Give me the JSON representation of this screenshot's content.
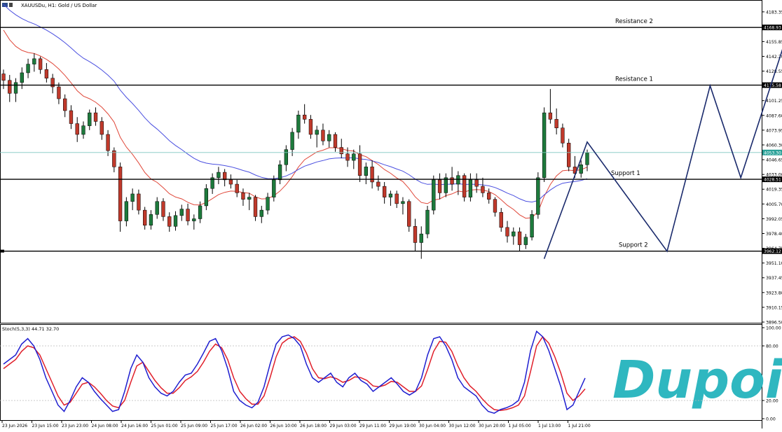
{
  "header": {
    "symbol_line": "XAUUSDu, H1: Gold / US Dollar",
    "stoch_label": "Stoch(5,3,3) 44.71 32.70"
  },
  "watermark": {
    "text": "Dupoin",
    "color": "#2fb7c0"
  },
  "colors": {
    "bull": "#1d7a3c",
    "bear": "#c0392b",
    "ma_fast": "#e0483a",
    "ma_slow": "#4a4fe0",
    "pattern": "#1a2a6c",
    "stoch_k": "#1f1fd0",
    "stoch_d": "#e01f2a",
    "current": "#2aa198"
  },
  "chart_data": [
    {
      "type": "candlestick",
      "title": "XAUUSDu, H1: Gold / US Dollar",
      "price_ticks": [
        "4183.35",
        "4169.60",
        "4155.85",
        "4142.20",
        "4128.55",
        "4115.58",
        "4101.25",
        "4087.60",
        "4073.95",
        "4060.30",
        "4053.30",
        "4046.65",
        "4033.00",
        "4028.51",
        "4019.35",
        "4005.70",
        "3992.05",
        "3978.40",
        "3964.75",
        "3962.12",
        "3951.10",
        "3937.45",
        "3923.80",
        "3910.15",
        "3896.50"
      ],
      "time_labels": [
        "23 Jun 2026",
        "23 Jun 15:00",
        "23 Jun 23:00",
        "24 Jun 08:00",
        "24 Jun 16:00",
        "25 Jun 01:00",
        "25 Jun 09:00",
        "25 Jun 17:00",
        "26 Jun 02:00",
        "26 Jun 10:00",
        "26 Jun 18:00",
        "29 Jun 03:00",
        "29 Jun 11:00",
        "29 Jun 19:00",
        "30 Jun 04:00",
        "30 Jun 12:00",
        "30 Jun 20:00",
        "1 Jul 05:00",
        "1 Jul 13:00",
        "1 Jul 21:00"
      ],
      "ylim": [
        3896.5,
        4193
      ],
      "levels": [
        {
          "name": "Resistance 2",
          "value": 4168.93,
          "tag": "4168.93"
        },
        {
          "name": "Resistance 1",
          "value": 4115.58,
          "tag": "4115.58"
        },
        {
          "name": "Support 1",
          "value": 4028.51,
          "tag": "4028.51"
        },
        {
          "name": "Support 2",
          "value": 3962.12,
          "tag": "3962.12"
        }
      ],
      "current_price": {
        "value": 4053.3,
        "tag": "4053.30"
      },
      "pattern_path": [
        [
          88,
          3955
        ],
        [
          95,
          4063
        ],
        [
          108,
          3962
        ],
        [
          115,
          4115
        ],
        [
          120,
          4030
        ],
        [
          128,
          4170
        ]
      ],
      "candles": [
        [
          4126,
          4130,
          4112,
          4120
        ],
        [
          4120,
          4125,
          4100,
          4108
        ],
        [
          4108,
          4122,
          4100,
          4118
        ],
        [
          4118,
          4132,
          4112,
          4127
        ],
        [
          4127,
          4140,
          4122,
          4135
        ],
        [
          4135,
          4145,
          4128,
          4140
        ],
        [
          4140,
          4142,
          4126,
          4130
        ],
        [
          4130,
          4136,
          4118,
          4122
        ],
        [
          4122,
          4126,
          4108,
          4114
        ],
        [
          4114,
          4118,
          4098,
          4103
        ],
        [
          4103,
          4107,
          4086,
          4092
        ],
        [
          4092,
          4097,
          4075,
          4080
        ],
        [
          4080,
          4086,
          4063,
          4070
        ],
        [
          4070,
          4082,
          4066,
          4078
        ],
        [
          4078,
          4093,
          4074,
          4090
        ],
        [
          4090,
          4095,
          4078,
          4082
        ],
        [
          4082,
          4086,
          4065,
          4070
        ],
        [
          4070,
          4074,
          4050,
          4055
        ],
        [
          4055,
          4058,
          4035,
          4040
        ],
        [
          4040,
          4044,
          3980,
          3990
        ],
        [
          3990,
          4012,
          3985,
          4008
        ],
        [
          4008,
          4020,
          4000,
          4015
        ],
        [
          4015,
          4019,
          3996,
          4000
        ],
        [
          4000,
          4003,
          3982,
          3986
        ],
        [
          3986,
          4000,
          3982,
          3996
        ],
        [
          3996,
          4012,
          3992,
          4008
        ],
        [
          4008,
          4011,
          3990,
          3994
        ],
        [
          3994,
          3998,
          3980,
          3985
        ],
        [
          3985,
          3999,
          3981,
          3995
        ],
        [
          3995,
          4005,
          3990,
          4001
        ],
        [
          4001,
          4006,
          3986,
          3990
        ],
        [
          3990,
          3996,
          3982,
          3992
        ],
        [
          3992,
          4008,
          3988,
          4004
        ],
        [
          4004,
          4024,
          4000,
          4020
        ],
        [
          4020,
          4034,
          4015,
          4030
        ],
        [
          4030,
          4040,
          4024,
          4035
        ],
        [
          4035,
          4038,
          4022,
          4028
        ],
        [
          4028,
          4033,
          4020,
          4024
        ],
        [
          4024,
          4028,
          4012,
          4016
        ],
        [
          4016,
          4020,
          4004,
          4010
        ],
        [
          4010,
          4016,
          4000,
          4012
        ],
        [
          4012,
          4014,
          3990,
          3994
        ],
        [
          3994,
          4004,
          3988,
          4000
        ],
        [
          4000,
          4016,
          3996,
          4012
        ],
        [
          4012,
          4032,
          4008,
          4028
        ],
        [
          4028,
          4046,
          4024,
          4042
        ],
        [
          4042,
          4060,
          4036,
          4056
        ],
        [
          4056,
          4076,
          4050,
          4072
        ],
        [
          4072,
          4092,
          4066,
          4088
        ],
        [
          4088,
          4098,
          4080,
          4084
        ],
        [
          4084,
          4088,
          4066,
          4070
        ],
        [
          4070,
          4078,
          4058,
          4074
        ],
        [
          4074,
          4080,
          4060,
          4064
        ],
        [
          4064,
          4074,
          4058,
          4070
        ],
        [
          4070,
          4072,
          4054,
          4058
        ],
        [
          4058,
          4066,
          4048,
          4052
        ],
        [
          4052,
          4058,
          4040,
          4046
        ],
        [
          4046,
          4056,
          4038,
          4052
        ],
        [
          4052,
          4060,
          4026,
          4032
        ],
        [
          4032,
          4044,
          4024,
          4040
        ],
        [
          4040,
          4046,
          4020,
          4026
        ],
        [
          4026,
          4032,
          4018,
          4022
        ],
        [
          4022,
          4026,
          4006,
          4012
        ],
        [
          4012,
          4018,
          4004,
          4015
        ],
        [
          4015,
          4018,
          4002,
          4006
        ],
        [
          4006,
          4012,
          3996,
          4008
        ],
        [
          4008,
          4010,
          3980,
          3985
        ],
        [
          3985,
          3992,
          3962,
          3970
        ],
        [
          3970,
          3985,
          3955,
          3978
        ],
        [
          3978,
          4004,
          3974,
          4000
        ],
        [
          4000,
          4032,
          3996,
          4028
        ],
        [
          4028,
          4034,
          4010,
          4016
        ],
        [
          4016,
          4034,
          4012,
          4030
        ],
        [
          4030,
          4040,
          4018,
          4024
        ],
        [
          4024,
          4036,
          4014,
          4032
        ],
        [
          4032,
          4034,
          4008,
          4012
        ],
        [
          4012,
          4034,
          4008,
          4028
        ],
        [
          4028,
          4034,
          4016,
          4022
        ],
        [
          4022,
          4030,
          4012,
          4016
        ],
        [
          4016,
          4020,
          4006,
          4010
        ],
        [
          4010,
          4012,
          3994,
          3998
        ],
        [
          3998,
          4002,
          3980,
          3984
        ],
        [
          3984,
          3990,
          3970,
          3976
        ],
        [
          3976,
          3984,
          3968,
          3980
        ],
        [
          3980,
          3984,
          3962,
          3968
        ],
        [
          3968,
          3978,
          3964,
          3975
        ],
        [
          3975,
          4000,
          3972,
          3996
        ],
        [
          3996,
          4035,
          3992,
          4030
        ],
        [
          4030,
          4095,
          4026,
          4090
        ],
        [
          4090,
          4112,
          4080,
          4084
        ],
        [
          4084,
          4094,
          4070,
          4076
        ],
        [
          4076,
          4080,
          4058,
          4062
        ],
        [
          4062,
          4066,
          4036,
          4040
        ],
        [
          4040,
          4050,
          4030,
          4034
        ],
        [
          4034,
          4046,
          4030,
          4042
        ],
        [
          4042,
          4056,
          4036,
          4053
        ]
      ]
    },
    {
      "type": "line",
      "title": "Stoch(5,3,3) 44.71 32.70",
      "ylim": [
        0,
        100
      ],
      "ticks": [
        "100.00",
        "80.00",
        "20.00",
        "0.00"
      ],
      "series": [
        {
          "name": "%K",
          "values": [
            60,
            65,
            70,
            82,
            88,
            80,
            65,
            45,
            30,
            15,
            8,
            20,
            35,
            45,
            40,
            30,
            22,
            15,
            8,
            10,
            30,
            55,
            70,
            62,
            45,
            35,
            28,
            25,
            30,
            40,
            48,
            50,
            60,
            72,
            85,
            88,
            75,
            55,
            30,
            20,
            15,
            12,
            18,
            35,
            60,
            82,
            90,
            92,
            88,
            80,
            60,
            45,
            40,
            45,
            50,
            40,
            35,
            45,
            50,
            42,
            38,
            30,
            35,
            40,
            45,
            38,
            30,
            26,
            30,
            45,
            70,
            88,
            90,
            80,
            65,
            45,
            35,
            30,
            25,
            15,
            8,
            6,
            10,
            12,
            15,
            20,
            40,
            75,
            96,
            90,
            75,
            55,
            35,
            10,
            15,
            30,
            44.71
          ]
        },
        {
          "name": "%D",
          "values": [
            55,
            60,
            65,
            74,
            80,
            78,
            70,
            55,
            40,
            25,
            15,
            18,
            28,
            38,
            40,
            35,
            28,
            20,
            14,
            12,
            20,
            40,
            58,
            62,
            52,
            42,
            34,
            28,
            28,
            34,
            42,
            46,
            52,
            62,
            74,
            82,
            78,
            65,
            45,
            30,
            22,
            16,
            16,
            25,
            45,
            68,
            83,
            88,
            90,
            85,
            72,
            55,
            45,
            44,
            46,
            44,
            40,
            42,
            46,
            45,
            42,
            36,
            35,
            37,
            41,
            40,
            35,
            30,
            30,
            36,
            54,
            74,
            85,
            84,
            74,
            58,
            45,
            36,
            30,
            22,
            15,
            10,
            9,
            10,
            12,
            15,
            25,
            52,
            80,
            90,
            83,
            68,
            50,
            28,
            20,
            25,
            32.7
          ]
        }
      ]
    }
  ]
}
